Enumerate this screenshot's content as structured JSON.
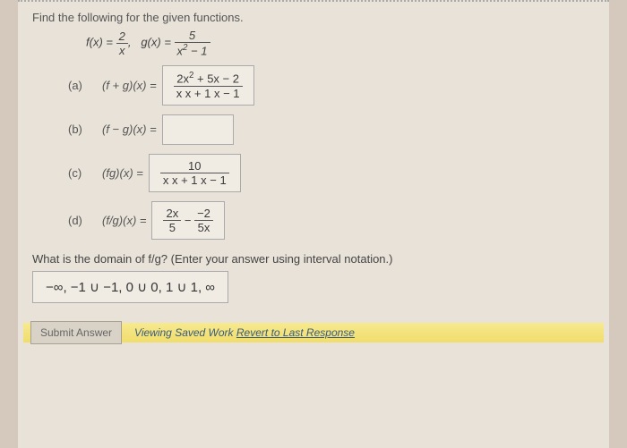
{
  "prompt": "Find the following for the given functions.",
  "functions": {
    "f_lhs": "f(x) =",
    "f_num": "2",
    "f_den": "x",
    "sep": ",",
    "g_lhs": "g(x) =",
    "g_num": "5",
    "g_den_pre": "x",
    "g_den_exp": "2",
    "g_den_post": " − 1"
  },
  "parts": {
    "a": {
      "label": "(a)",
      "expr": "(f + g)(x) =",
      "ans_num_pre": "2x",
      "ans_num_exp": "2",
      "ans_num_post": " + 5x − 2",
      "ans_den": "x  x + 1    x − 1"
    },
    "b": {
      "label": "(b)",
      "expr": "(f − g)(x) =",
      "ans": ""
    },
    "c": {
      "label": "(c)",
      "expr": "(fg)(x) =",
      "ans_num": "10",
      "ans_den": "x  x + 1    x − 1"
    },
    "d": {
      "label": "(d)",
      "expr": "(f/g)(x) =",
      "t1_num": "2x",
      "t1_den": "5",
      "minus": "−",
      "t2_num": "−2",
      "t2_den": "5x"
    }
  },
  "domain_q": "What is the domain of f/g? (Enter your answer using interval notation.)",
  "domain_ans": "−∞, −1  ∪  −1, 0  ∪  0, 1  ∪  1, ∞",
  "footer": {
    "submit": "Submit Answer",
    "viewing": "Viewing Saved Work ",
    "revert": "Revert to Last Response"
  }
}
